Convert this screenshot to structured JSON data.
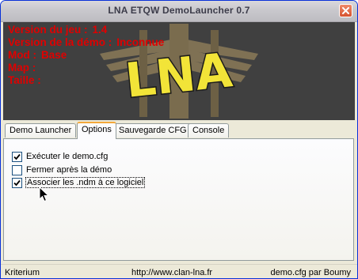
{
  "window": {
    "title": "LNA ETQW DemoLauncher 0.7"
  },
  "banner": {
    "game_version_label": "Version du jeu :",
    "game_version_value": "1.4",
    "demo_version_label": "Version de la démo :",
    "demo_version_value": "Inconnue",
    "mod_label": "Mod :",
    "mod_value": "Base",
    "map_label": "Map :",
    "size_label": "Taille :",
    "logo_text": "LNA"
  },
  "tabs": [
    {
      "label": "Demo Launcher",
      "active": false
    },
    {
      "label": "Options",
      "active": true
    },
    {
      "label": "Sauvegarde CFG",
      "active": false
    },
    {
      "label": "Console",
      "active": false
    }
  ],
  "options": [
    {
      "label": "Exécuter le demo.cfg",
      "checked": true
    },
    {
      "label": "Fermer après la démo",
      "checked": false
    },
    {
      "label": "Associer les .ndm à ce logiciel",
      "checked": true
    }
  ],
  "status": {
    "left": "Kriterium",
    "middle": "http://www.clan-lna.fr",
    "right": "demo.cfg par Boumy"
  },
  "colors": {
    "banner_bg": "#404040",
    "banner_text": "#e00000",
    "logo_fill": "#f2e438",
    "tab_highlight": "#f3a83a",
    "close_button": "#d65330"
  }
}
